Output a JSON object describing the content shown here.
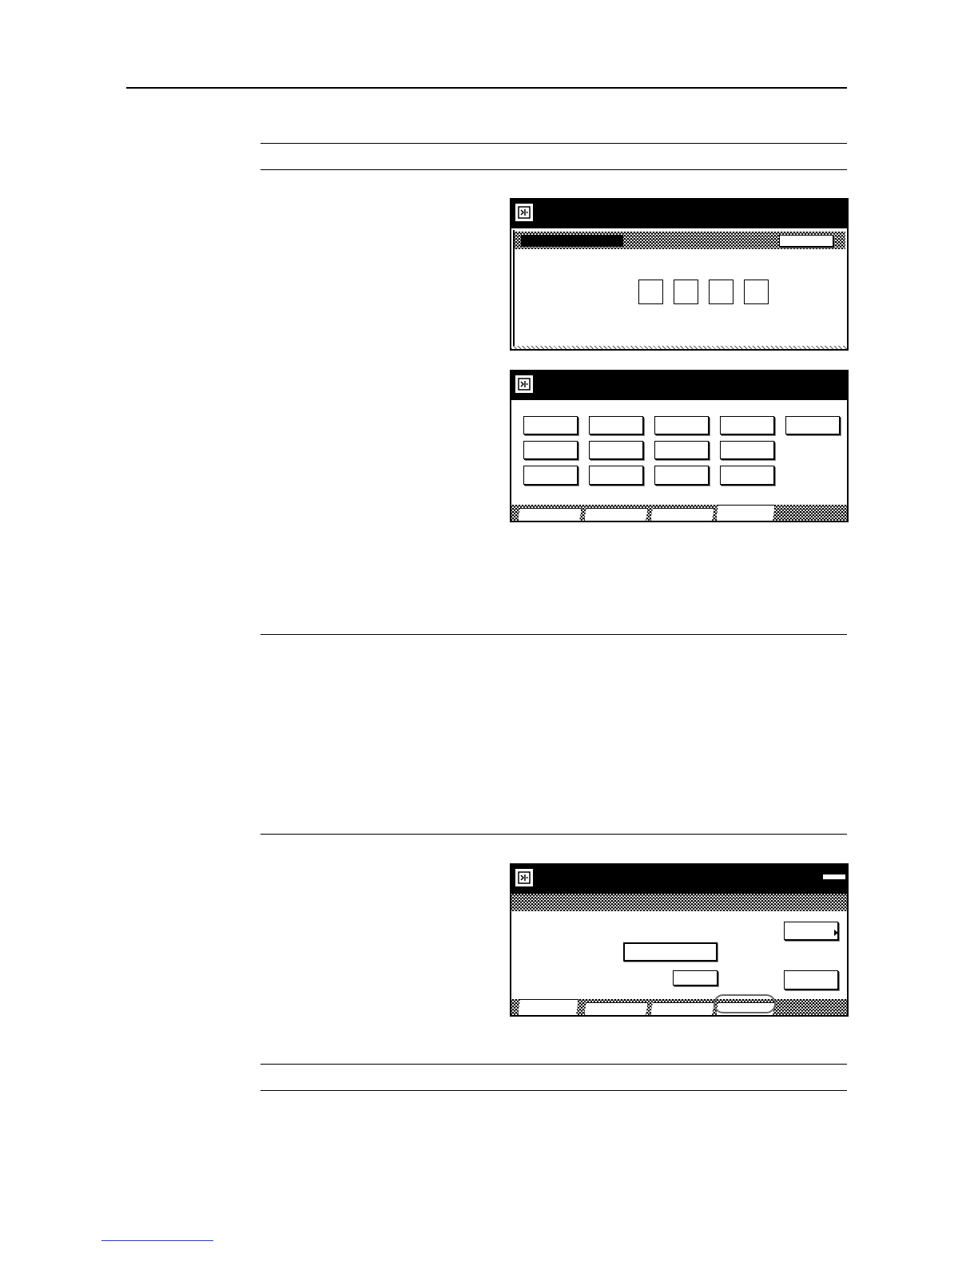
{
  "document": {
    "rules": [
      {
        "id": "header-rule"
      },
      {
        "id": "section-1-top"
      },
      {
        "id": "section-1-bottom"
      },
      {
        "id": "section-2-top"
      },
      {
        "id": "section-3-top"
      },
      {
        "id": "section-4-top"
      },
      {
        "id": "section-4-bottom"
      }
    ]
  },
  "screens": {
    "code_entry": {
      "digit_count": 4,
      "has_header_button": true
    },
    "function_menu": {
      "button_rows": [
        5,
        4,
        4
      ],
      "tab_count": 4,
      "active_tab": 4
    },
    "settings": {
      "tab_count": 4,
      "active_tab": 1,
      "highlighted_tab": 4
    }
  },
  "icons": {
    "panel": "copier-panel-icon",
    "arrow": "arrow-right-icon"
  },
  "colors": {
    "ink": "#000000",
    "footer_link": "#2a3bbf"
  }
}
